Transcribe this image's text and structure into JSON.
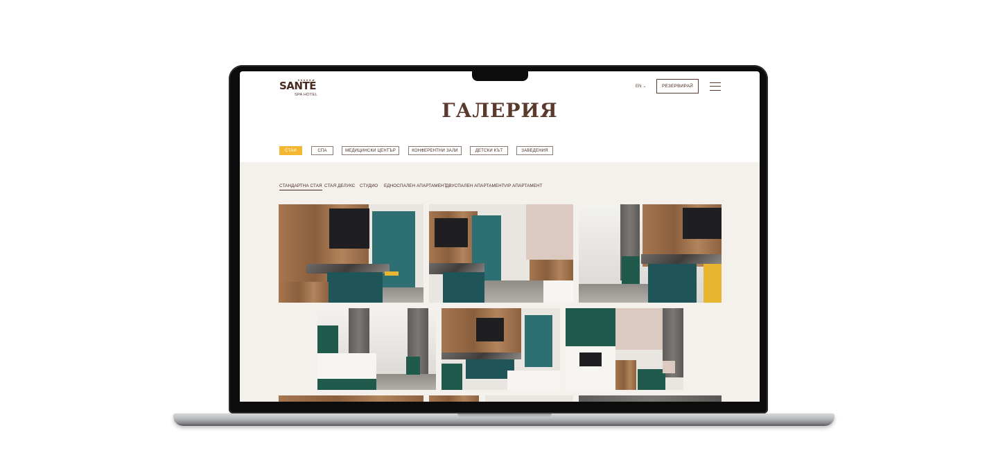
{
  "header": {
    "logo_main": "SANTÉ",
    "logo_sub": "SPA HOTEL",
    "logo_stars": "★★★★★",
    "language": "EN",
    "book_label": "РЕЗЕРВИРАЙ"
  },
  "page": {
    "title": "ГАЛЕРИЯ"
  },
  "categories": [
    {
      "label": "СТАИ",
      "active": true
    },
    {
      "label": "СПА",
      "active": false
    },
    {
      "label": "МЕДИЦИНСКИ ЦЕНТЪР",
      "active": false
    },
    {
      "label": "КОНФЕРЕНТНИ ЗАЛИ",
      "active": false
    },
    {
      "label": "ДЕТСКИ КЪТ",
      "active": false
    },
    {
      "label": "ЗАВЕДЕНИЯ",
      "active": false
    }
  ],
  "subtabs": [
    {
      "label": "СТАНДАРТНА СТАЯ",
      "active": true
    },
    {
      "label": "СТАЯ ДЕЛУКС",
      "active": false
    },
    {
      "label": "СТУДИО",
      "active": false
    },
    {
      "label": "ЕДНОСПАЛЕН АПАРТАМЕНТ",
      "active": false
    },
    {
      "label": "ДВУСПАЛЕН АПАРТАМЕНТ",
      "active": false
    },
    {
      "label": "VIP АПАРТАМЕНТ",
      "active": false
    }
  ],
  "colors": {
    "accent": "#f4b731",
    "brand_brown": "#5b3a2e",
    "content_bg": "#f4f1ec"
  }
}
